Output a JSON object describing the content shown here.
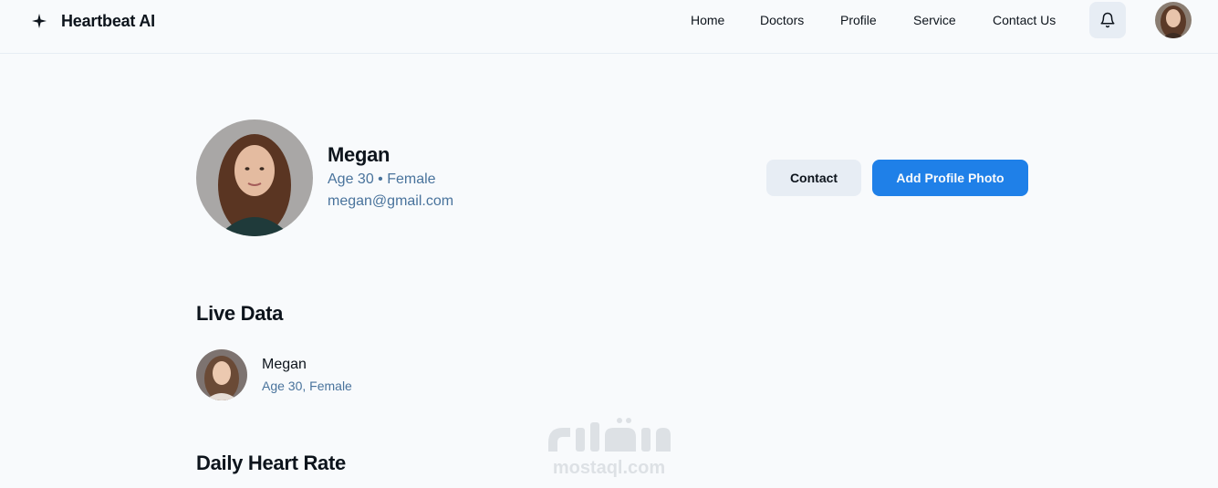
{
  "header": {
    "brand": "Heartbeat AI",
    "logo_icon": "sparkle-icon",
    "nav": [
      {
        "label": "Home"
      },
      {
        "label": "Doctors"
      },
      {
        "label": "Profile"
      },
      {
        "label": "Service"
      },
      {
        "label": "Contact Us"
      }
    ],
    "notification_icon": "bell-icon",
    "avatar": "user-avatar"
  },
  "profile": {
    "name": "Megan",
    "meta": "Age 30 • Female",
    "email": "megan@gmail.com",
    "contact_label": "Contact",
    "add_photo_label": "Add Profile Photo"
  },
  "live_data": {
    "title": "Live Data",
    "name": "Megan",
    "meta": "Age 30, Female"
  },
  "daily_heart_rate": {
    "title": "Daily Heart Rate"
  },
  "watermark": {
    "text": "mostaql.com"
  },
  "colors": {
    "background": "#f8fafc",
    "primary": "#1f80e8",
    "secondary_button": "#e7edf4",
    "muted_text": "#49739c",
    "text": "#0d141c"
  }
}
